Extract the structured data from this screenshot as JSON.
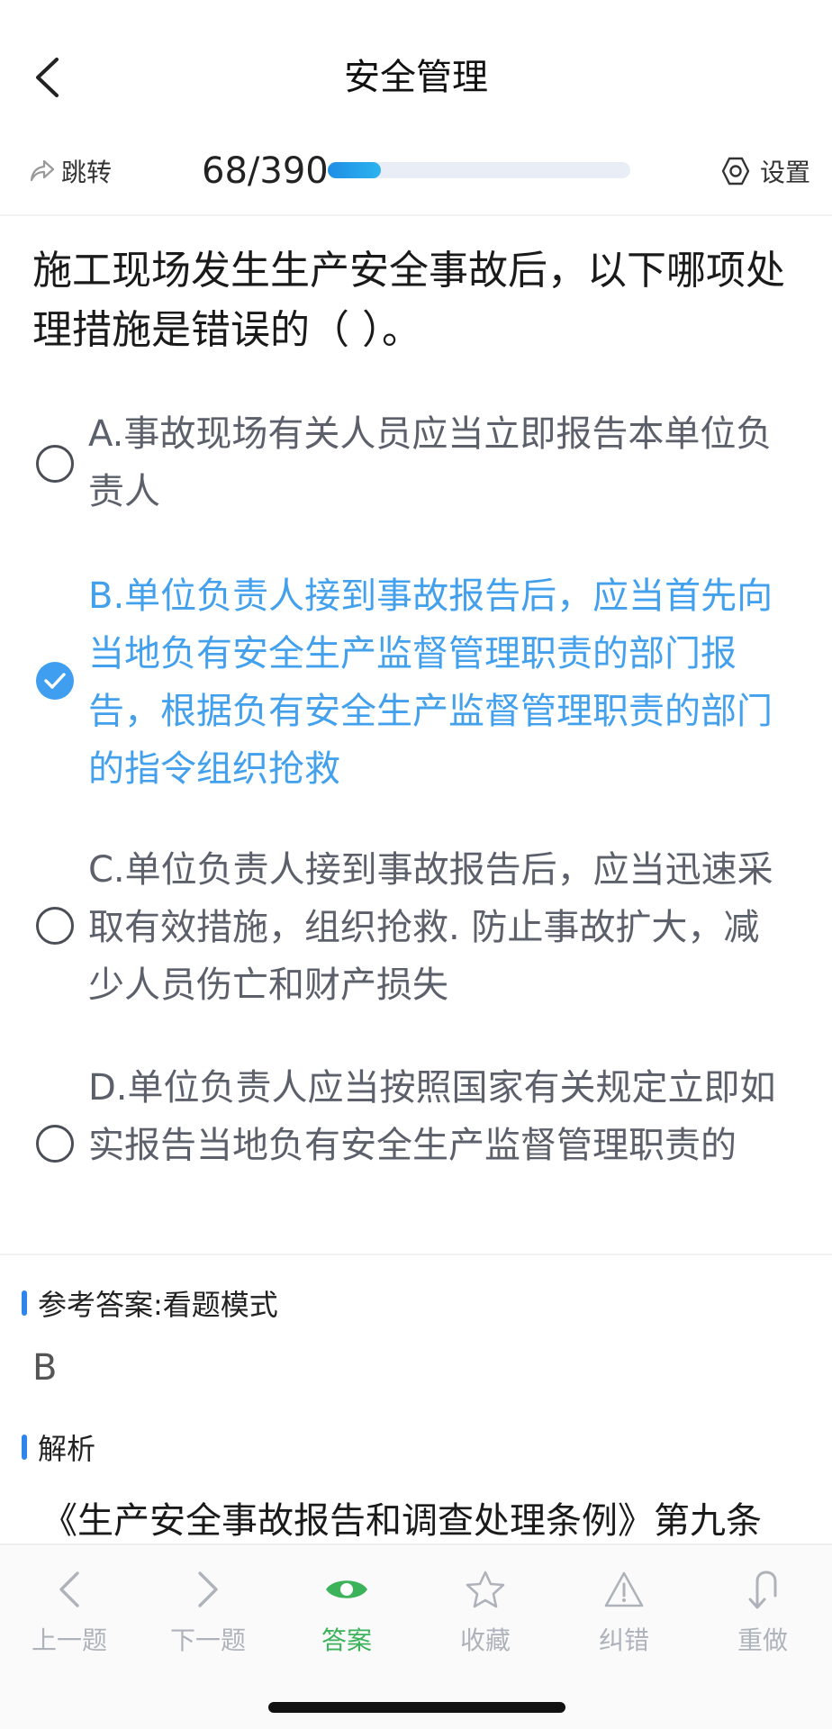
{
  "header": {
    "title": "安全管理"
  },
  "progress": {
    "jump_label": "跳转",
    "counter": "68/390",
    "current": 68,
    "total": 390,
    "settings_label": "设置"
  },
  "question": {
    "text": "施工现场发生生产安全事故后，以下哪项处理措施是错误的（ ）。"
  },
  "options": [
    {
      "text": "A.事故现场有关人员应当立即报告本单位负责人",
      "selected": false
    },
    {
      "text": "B.单位负责人接到事故报告后，应当首先向当地负有安全生产监督管理职责的部门报告，根据负有安全生产监督管理职责的部门的指令组织抢救",
      "selected": true
    },
    {
      "text": "C.单位负责人接到事故报告后，应当迅速采取有效措施，组织抢救. 防止事故扩大，减少人员伤亡和财产损失",
      "selected": false
    },
    {
      "text": "D.单位负责人应当按照国家有关规定立即如实报告当地负有安全生产监督管理职责的",
      "selected": false
    }
  ],
  "answer": {
    "label": "参考答案:看题模式",
    "value": "B"
  },
  "analysis": {
    "label": "解析",
    "text": "《生产安全事故报告和调查处理条例》第九条"
  },
  "nav": {
    "prev": "上一题",
    "next": "下一题",
    "answer": "答案",
    "favorite": "收藏",
    "report": "纠错",
    "redo": "重做"
  },
  "colors": {
    "accent_blue": "#43a0ec",
    "active_green": "#3cb35a",
    "section_bar": "#2f86ea"
  }
}
